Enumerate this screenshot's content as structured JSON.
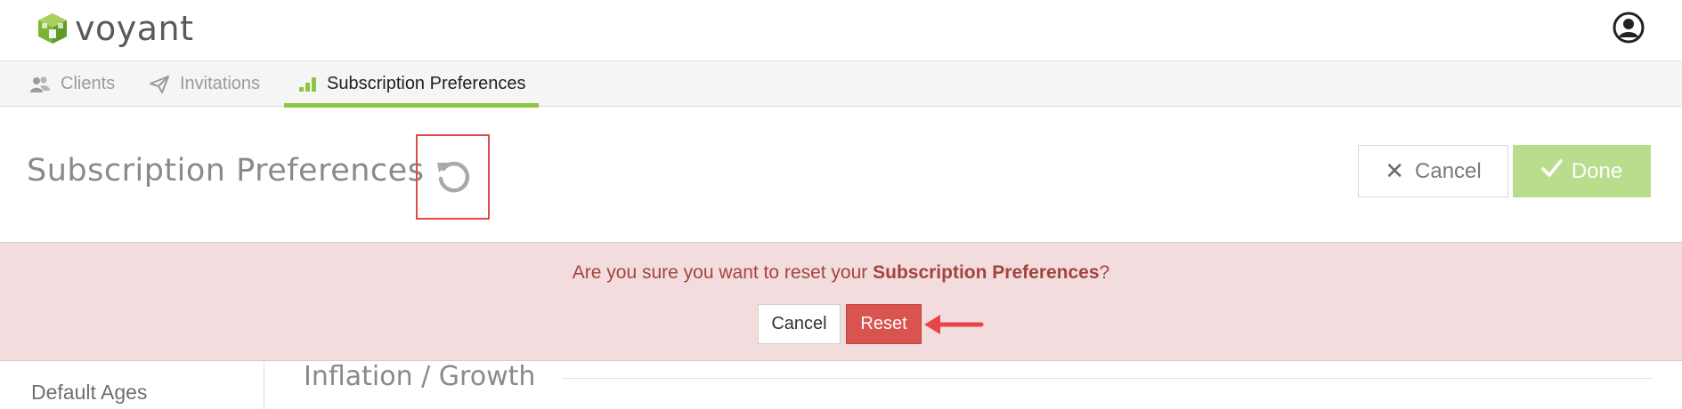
{
  "app": {
    "logo_text": "voyant"
  },
  "tabs": [
    {
      "label": "Clients",
      "icon": "users-icon",
      "active": false
    },
    {
      "label": "Invitations",
      "icon": "paper-plane-icon",
      "active": false
    },
    {
      "label": "Subscription Preferences",
      "icon": "bar-chart-icon",
      "active": true
    }
  ],
  "header": {
    "title": "Subscription Preferences",
    "cancel_label": "Cancel",
    "done_label": "Done"
  },
  "confirm": {
    "message_prefix": "Are you sure you want to reset your ",
    "message_bold": "Subscription Preferences",
    "message_suffix": "?",
    "cancel_label": "Cancel",
    "reset_label": "Reset"
  },
  "sidebar": {
    "items": [
      {
        "label": "Default Ages"
      }
    ]
  },
  "main": {
    "section_title": "Inflation / Growth"
  },
  "colors": {
    "accent_green": "#8dc63f",
    "done_button": "#b7dd8d",
    "danger": "#d9534f",
    "confirm_bg": "#f2dcde",
    "highlight_box": "#e24a4a"
  }
}
